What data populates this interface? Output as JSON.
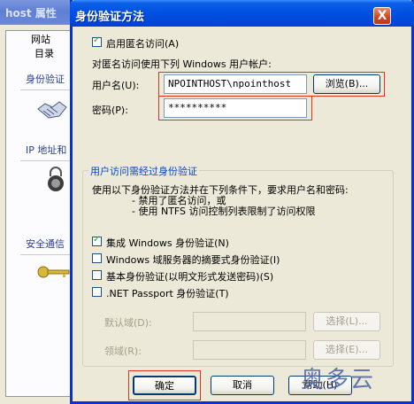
{
  "background_window": {
    "title": "host 属性",
    "tabs": [
      "网站",
      "目录"
    ],
    "sections": [
      "身份验证",
      "IP 地址和",
      "安全通信"
    ]
  },
  "dialog": {
    "title": "身份验证方法",
    "close_label": "X",
    "anonymous": {
      "checkbox_label": "启用匿名访问(A)",
      "checked": true,
      "description": "对匿名访问使用下列 Windows 用户帐户:",
      "username_label": "用户名(U):",
      "username_value": "NPOINTHOST\\npointhost",
      "browse_label": "浏览(B)...",
      "password_label": "密码(P):",
      "password_value": "**********"
    },
    "auth_group": {
      "title": "用户访问需经过身份验证",
      "description": "使用以下身份验证方法并在下列条件下，要求用户名和密码:",
      "condition1": "- 禁用了匿名访问，或",
      "condition2": "- 使用 NTFS 访问控制列表限制了访问权限",
      "options": [
        {
          "label": "集成 Windows 身份验证(N)",
          "checked": true
        },
        {
          "label": "Windows 域服务器的摘要式身份验证(I)",
          "checked": false
        },
        {
          "label": "基本身份验证(以明文形式发送密码)(S)",
          "checked": false
        },
        {
          "label": ".NET Passport 身份验证(T)",
          "checked": false
        }
      ],
      "default_domain_label": "默认域(D):",
      "realm_label": "领域(R):",
      "select_label": "选择(L)...",
      "select2_label": "选择(E)..."
    },
    "buttons": {
      "ok": "确定",
      "cancel": "取消",
      "help": "帮助(H)"
    }
  },
  "watermark": "奥多云",
  "colors": {
    "title_blue": "#0050e0",
    "highlight_red": "#e0341a",
    "group_title": "#0046d5"
  }
}
